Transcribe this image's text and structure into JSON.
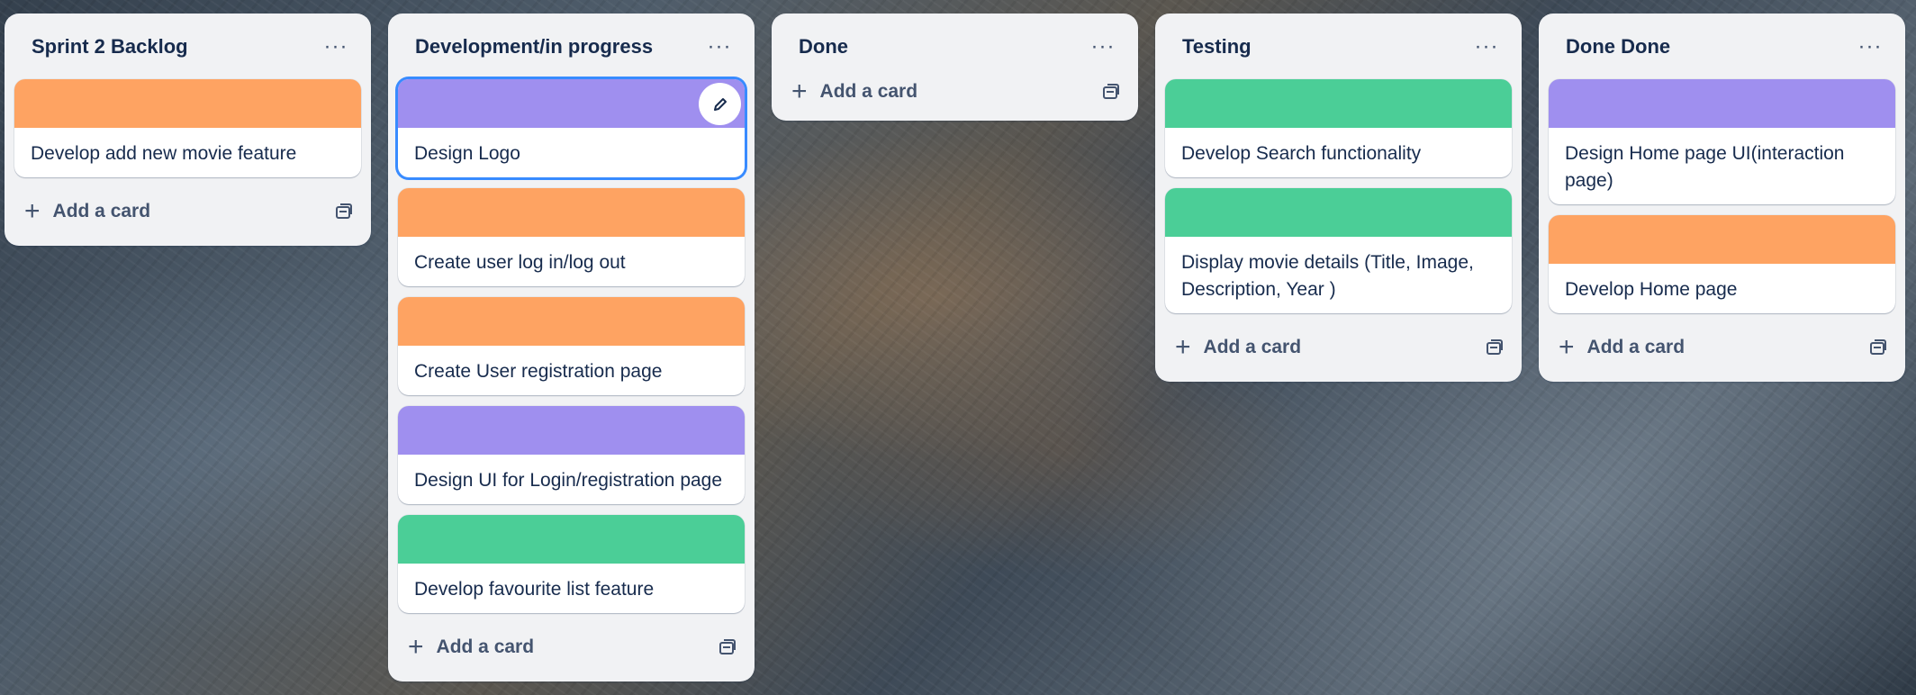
{
  "lists": [
    {
      "title": "Sprint 2 Backlog",
      "menu_icon": "ellipsis-icon",
      "cards": [
        {
          "title": "Develop add new movie feature",
          "cover_color": "#fea362"
        }
      ],
      "add_label": "Add a card"
    },
    {
      "title": "Development/in progress",
      "menu_icon": "ellipsis-icon",
      "cards": [
        {
          "title": "Design Logo",
          "cover_color": "#9f8fef",
          "focused": true
        },
        {
          "title": "Create user log in/log out",
          "cover_color": "#fea362"
        },
        {
          "title": "Create User registration page",
          "cover_color": "#fea362"
        },
        {
          "title": "Design UI for Login/registration page",
          "cover_color": "#9f8fef"
        },
        {
          "title": "Develop favourite list feature",
          "cover_color": "#4bce97"
        }
      ],
      "add_label": "Add a card"
    },
    {
      "title": "Done",
      "menu_icon": "ellipsis-icon",
      "cards": [],
      "add_label": "Add a card"
    },
    {
      "title": "Testing",
      "menu_icon": "ellipsis-icon",
      "cards": [
        {
          "title": "Develop Search functionality",
          "cover_color": "#4bce97"
        },
        {
          "title": "Display movie details (Title, Image, Description, Year )",
          "cover_color": "#4bce97"
        }
      ],
      "add_label": "Add a card"
    },
    {
      "title": "Done Done",
      "menu_icon": "ellipsis-icon",
      "cards": [
        {
          "title": "Design Home page UI(interaction page)",
          "cover_color": "#9f8fef"
        },
        {
          "title": "Develop Home page",
          "cover_color": "#fea362"
        }
      ],
      "add_label": "Add a card"
    }
  ],
  "icons": {
    "edit": "pencil-icon",
    "add": "plus-icon",
    "template": "card-template-icon"
  }
}
